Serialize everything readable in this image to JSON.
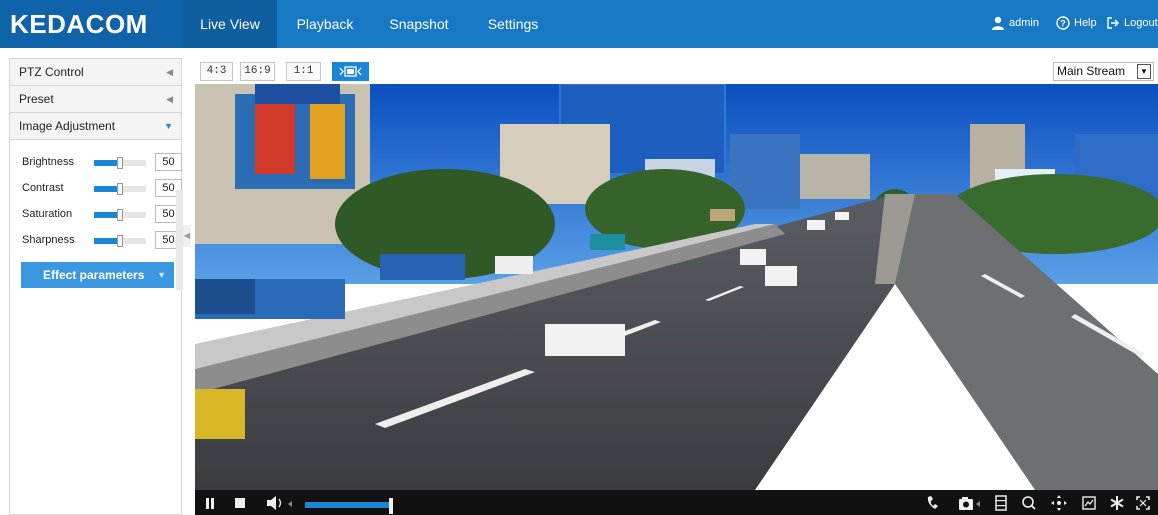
{
  "app": {
    "brand": "KEDACOM",
    "nav": [
      "Live View",
      "Playback",
      "Snapshot",
      "Settings"
    ],
    "active_nav": "Live View",
    "user": "admin",
    "help": "Help",
    "logout": "Logout"
  },
  "sidebar": {
    "sections": [
      "PTZ Control",
      "Preset",
      "Image Adjustment"
    ],
    "open_section": "Image Adjustment",
    "adjustments": [
      {
        "label": "Brightness",
        "value": "50",
        "level": 0.5
      },
      {
        "label": "Contrast",
        "value": "50",
        "level": 0.5
      },
      {
        "label": "Saturation",
        "value": "50",
        "level": 0.5
      },
      {
        "label": "Sharpness",
        "value": "50",
        "level": 0.5
      }
    ],
    "effect_button": "Effect parameters"
  },
  "video_toolbar": {
    "ratios": [
      "4:3",
      "16:9",
      "1:1"
    ],
    "stream": "Main Stream"
  },
  "player": {
    "volume_level": 0.95,
    "icons": [
      "pause-icon",
      "stop-icon",
      "volume-icon",
      "intercom-icon",
      "snapshot-icon",
      "record-icon",
      "zoom-icon",
      "ptz-icon",
      "stats-icon",
      "settings-icon",
      "fullscreen-icon"
    ]
  },
  "colors": {
    "header": "#1778c4",
    "accent": "#1a86d6",
    "button": "#3a97e0"
  }
}
